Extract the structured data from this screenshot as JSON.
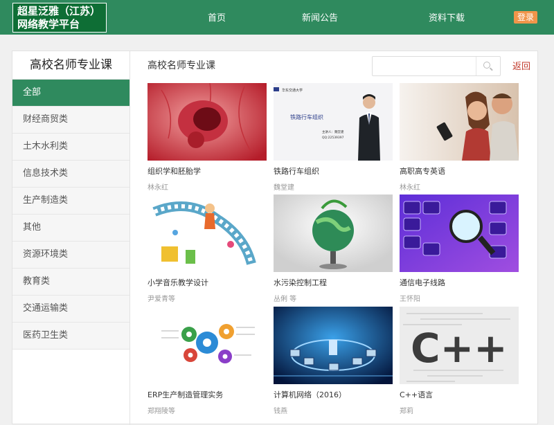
{
  "header": {
    "logo_line1": "超星泛雅（江苏）",
    "logo_line2": "网络教学平台",
    "nav": [
      "首页",
      "新闻公告",
      "资料下载"
    ],
    "login_label": "登录"
  },
  "sidebar": {
    "title": "高校名师专业课",
    "items": [
      "全部",
      "财经商贸类",
      "土木水利类",
      "信息技术类",
      "生产制造类",
      "其他",
      "资源环境类",
      "教育类",
      "交通运输类",
      "医药卫生类"
    ],
    "active_index": 0
  },
  "main": {
    "title": "高校名师专业课",
    "search": {
      "placeholder": ""
    },
    "back_label": "返回",
    "courses": [
      {
        "title": "组织学和胚胎学",
        "author": "林永红",
        "thumb": "embryo"
      },
      {
        "title": "铁路行车组织",
        "author": "魏堂建",
        "thumb": "railway-lecture",
        "thumb_text": {
          "school": "华东交通大学",
          "heading": "铁路行车组织",
          "lecturer": "主讲人：魏堂建",
          "qq": "QQ:22539397"
        }
      },
      {
        "title": "高职高专英语",
        "author": "林永红",
        "thumb": "couple-phone"
      },
      {
        "title": "小学音乐教学设计",
        "author": "尹爱青等",
        "thumb": "music-cartoon"
      },
      {
        "title": "水污染控制工程",
        "author": "丛俐 等",
        "thumb": "green-globe"
      },
      {
        "title": "通信电子线路",
        "author": "王怀阳",
        "thumb": "keyboard-magnifier"
      },
      {
        "title": "ERP生产制造管理实务",
        "author": "郑翔陵等",
        "thumb": "erp-gears"
      },
      {
        "title": "计算机网络（2016）",
        "author": "钱燕",
        "thumb": "computer-network"
      },
      {
        "title": "C++语言",
        "author": "郑莉",
        "thumb": "cpp",
        "thumb_text": {
          "logo": "C++"
        }
      }
    ]
  },
  "colors": {
    "primary": "#2f8a5e",
    "logo_bg": "#0e6e35",
    "login": "#f0954a",
    "back": "#c0392b"
  }
}
